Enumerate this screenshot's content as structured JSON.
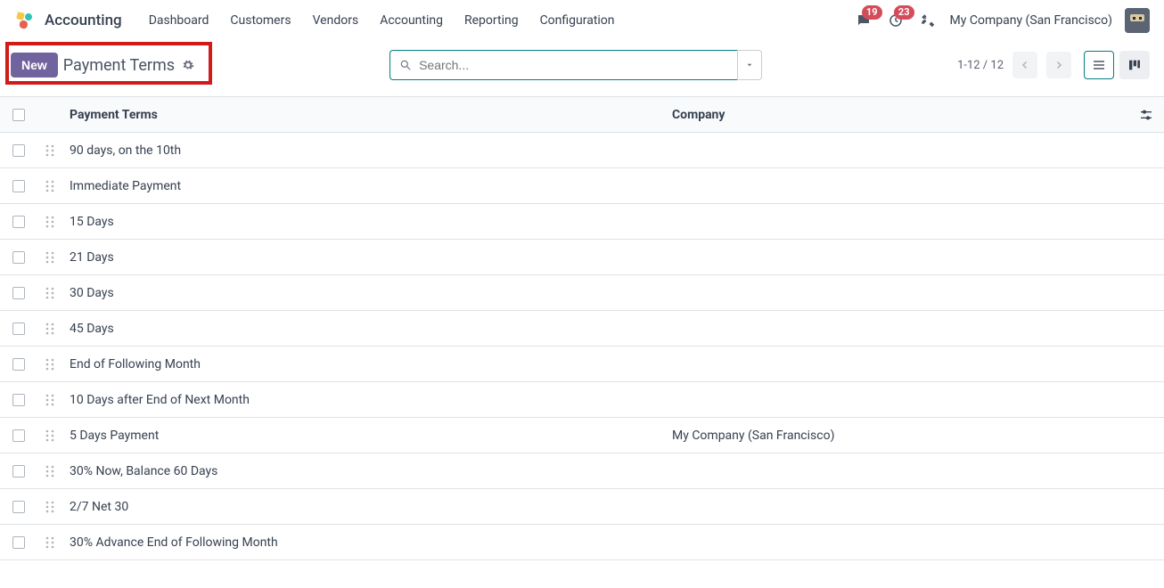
{
  "nav": {
    "app_title": "Accounting",
    "links": [
      "Dashboard",
      "Customers",
      "Vendors",
      "Accounting",
      "Reporting",
      "Configuration"
    ],
    "messages_badge": "19",
    "activities_badge": "23",
    "company": "My Company (San Francisco)"
  },
  "control": {
    "new_label": "New",
    "breadcrumb": "Payment Terms",
    "search_placeholder": "Search...",
    "pager": "1-12 / 12"
  },
  "table": {
    "headers": {
      "name": "Payment Terms",
      "company": "Company"
    },
    "rows": [
      {
        "name": "90 days, on the 10th",
        "company": ""
      },
      {
        "name": "Immediate Payment",
        "company": ""
      },
      {
        "name": "15 Days",
        "company": ""
      },
      {
        "name": "21 Days",
        "company": ""
      },
      {
        "name": "30 Days",
        "company": ""
      },
      {
        "name": "45 Days",
        "company": ""
      },
      {
        "name": "End of Following Month",
        "company": ""
      },
      {
        "name": "10 Days after End of Next Month",
        "company": ""
      },
      {
        "name": "5 Days Payment",
        "company": "My Company (San Francisco)"
      },
      {
        "name": "30% Now, Balance 60 Days",
        "company": ""
      },
      {
        "name": "2/7 Net 30",
        "company": ""
      },
      {
        "name": "30% Advance End of Following Month",
        "company": ""
      }
    ]
  }
}
